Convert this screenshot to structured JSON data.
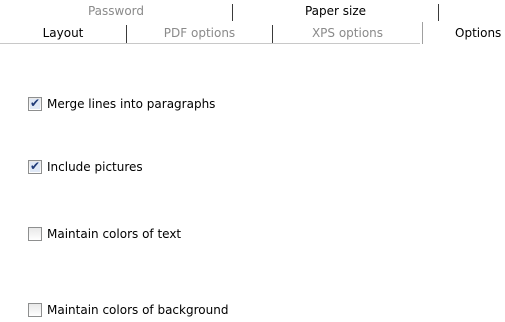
{
  "tabs_back_row": [
    {
      "label": "Password",
      "enabled": false
    },
    {
      "label": "Paper size",
      "enabled": true
    },
    {
      "label": "",
      "enabled": false
    }
  ],
  "tabs_front_row": [
    {
      "label": "Layout",
      "enabled": true
    },
    {
      "label": "PDF options",
      "enabled": false
    },
    {
      "label": "XPS options",
      "enabled": false
    },
    {
      "label": "Options",
      "enabled": true,
      "selected": true
    }
  ],
  "options": [
    {
      "label": "Merge lines into paragraphs",
      "checked": true
    },
    {
      "label": "Include pictures",
      "checked": true
    },
    {
      "label": "Maintain colors of text",
      "checked": false
    },
    {
      "label": "Maintain colors of background",
      "checked": false
    }
  ],
  "colors": {
    "checkmark": "#1f3a78",
    "disabled_text": "#8a8a8a",
    "separator": "#3a3a3a"
  },
  "icons": {
    "checked": "check-icon"
  }
}
